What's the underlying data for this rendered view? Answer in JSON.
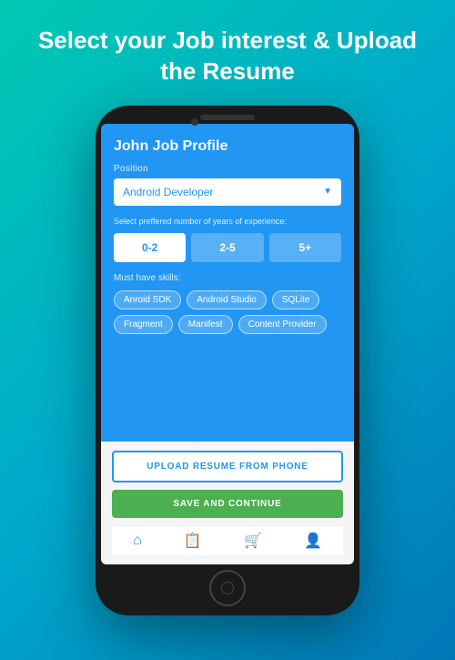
{
  "page": {
    "title": "Select your Job interest &\nUpload the  Resume",
    "background": "#00b4c8"
  },
  "phone": {
    "screen": {
      "profile_title": "John Job Profile",
      "position_label": "Position",
      "position_value": "Android Developer",
      "experience_label": "Select preffered number of years of experience:",
      "experience_options": [
        {
          "label": "0-2",
          "active": true
        },
        {
          "label": "2-5",
          "active": false
        },
        {
          "label": "5+",
          "active": false
        }
      ],
      "skills_label": "Must have skills:",
      "skills": [
        "Anroid SDK",
        "Android Studio",
        "SQLite",
        "Fragment",
        "Manifest",
        "Content Provider"
      ],
      "upload_btn_label": "UPLOAD RESUME FROM PHONE",
      "save_btn_label": "SAVE AND CONTINUE",
      "nav_icons": [
        "home",
        "document",
        "cart",
        "person"
      ]
    }
  }
}
